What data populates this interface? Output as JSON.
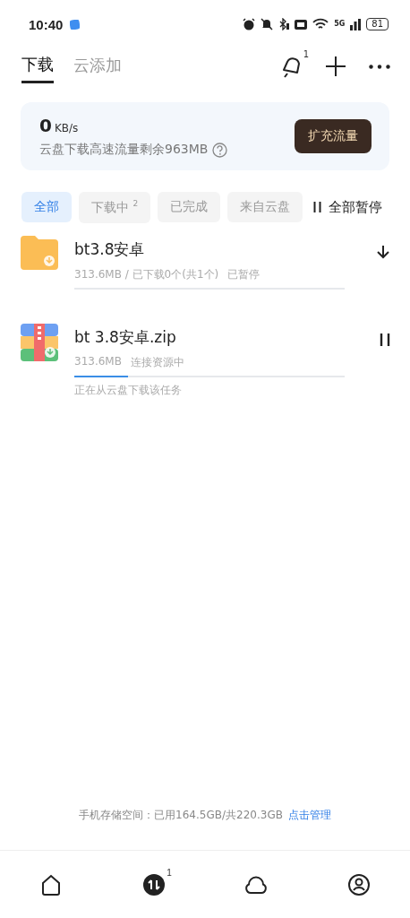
{
  "status_bar": {
    "time": "10:40",
    "network": "5G",
    "battery": "81"
  },
  "header": {
    "tabs": [
      {
        "label": "下载",
        "selected": true
      },
      {
        "label": "云添加",
        "selected": false
      }
    ],
    "notification_badge": "1"
  },
  "speed_card": {
    "speed": "0",
    "unit": "KB/s",
    "quota_text": "云盘下载高速流量剩余963MB",
    "button": "扩充流量"
  },
  "filters": [
    {
      "label": "全部",
      "selected": true
    },
    {
      "label": "下载中",
      "badge": "2",
      "selected": false
    },
    {
      "label": "已完成",
      "selected": false
    },
    {
      "label": "来自云盘",
      "selected": false
    }
  ],
  "pause_all": "全部暂停",
  "downloads": [
    {
      "kind": "folder",
      "paused": true,
      "name": "bt3.8安卓",
      "size": "313.6MB / 已下载0个(共1个)",
      "status": "已暂停"
    },
    {
      "kind": "zip",
      "paused": false,
      "name": "bt 3.8安卓.zip",
      "size": "313.6MB",
      "status": "连接资源中",
      "level": 0.2,
      "note": "正在从云盘下载该任务"
    }
  ],
  "storage": {
    "text": "手机存储空间：已用164.5GB/共220.3GB",
    "link": "点击管理"
  },
  "nav": [
    {
      "kind": "home",
      "selected": false
    },
    {
      "kind": "transfer",
      "selected": true,
      "badge": "1"
    },
    {
      "kind": "cloud",
      "selected": false
    },
    {
      "kind": "profile",
      "selected": false
    }
  ]
}
